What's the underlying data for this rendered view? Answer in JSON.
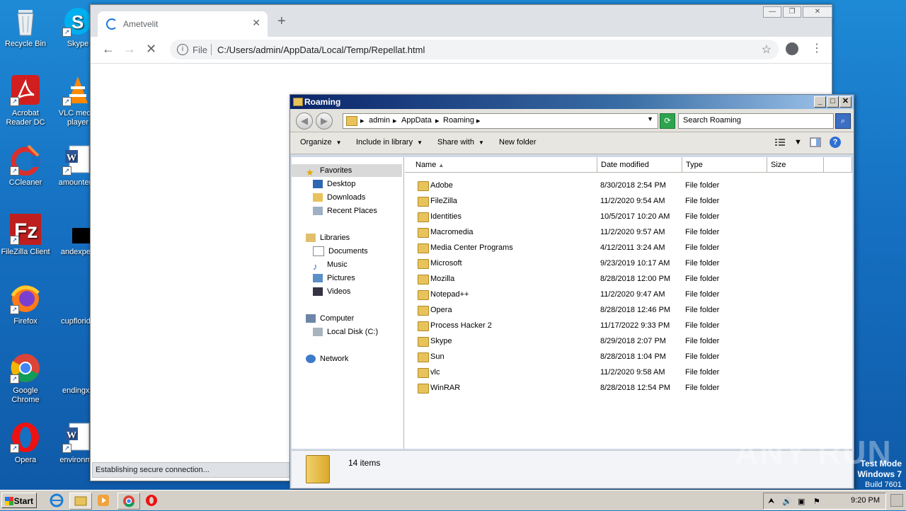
{
  "desktop": {
    "icons": [
      {
        "name": "Recycle Bin"
      },
      {
        "name": "Skype"
      },
      {
        "name": "Acrobat Reader DC"
      },
      {
        "name": "VLC media player"
      },
      {
        "name": "CCleaner"
      },
      {
        "name": "amountenc"
      },
      {
        "name": "FileZilla Client"
      },
      {
        "name": "andexperi"
      },
      {
        "name": "Firefox"
      },
      {
        "name": "cupflorida"
      },
      {
        "name": "Google Chrome"
      },
      {
        "name": "endingxx"
      },
      {
        "name": "Opera"
      },
      {
        "name": "environme"
      }
    ]
  },
  "chrome": {
    "tab_title": "Ametvelit",
    "tab_close": "✕",
    "new_tab": "+",
    "omnibox_scheme": "File",
    "url": "C:/Users/admin/AppData/Local/Temp/Repellat.html",
    "status": "Establishing secure connection..."
  },
  "explorer": {
    "title": "Roaming",
    "breadcrumb": [
      "admin",
      "AppData",
      "Roaming"
    ],
    "search_placeholder": "Search Roaming",
    "toolbar": {
      "organize": "Organize",
      "include": "Include in library",
      "share": "Share with",
      "new_folder": "New folder"
    },
    "nav": {
      "favorites": "Favorites",
      "desktop": "Desktop",
      "downloads": "Downloads",
      "recent": "Recent Places",
      "libraries": "Libraries",
      "documents": "Documents",
      "music": "Music",
      "pictures": "Pictures",
      "videos": "Videos",
      "computer": "Computer",
      "local_disk": "Local Disk (C:)",
      "network": "Network"
    },
    "columns": {
      "name": "Name",
      "date": "Date modified",
      "type": "Type",
      "size": "Size"
    },
    "files": [
      {
        "name": "Adobe",
        "date": "8/30/2018 2:54 PM",
        "type": "File folder"
      },
      {
        "name": "FileZilla",
        "date": "11/2/2020 9:54 AM",
        "type": "File folder"
      },
      {
        "name": "Identities",
        "date": "10/5/2017 10:20 AM",
        "type": "File folder"
      },
      {
        "name": "Macromedia",
        "date": "11/2/2020 9:57 AM",
        "type": "File folder"
      },
      {
        "name": "Media Center Programs",
        "date": "4/12/2011 3:24 AM",
        "type": "File folder"
      },
      {
        "name": "Microsoft",
        "date": "9/23/2019 10:17 AM",
        "type": "File folder"
      },
      {
        "name": "Mozilla",
        "date": "8/28/2018 12:00 PM",
        "type": "File folder"
      },
      {
        "name": "Notepad++",
        "date": "11/2/2020 9:47 AM",
        "type": "File folder"
      },
      {
        "name": "Opera",
        "date": "8/28/2018 12:46 PM",
        "type": "File folder"
      },
      {
        "name": "Process Hacker 2",
        "date": "11/17/2022 9:33 PM",
        "type": "File folder"
      },
      {
        "name": "Skype",
        "date": "8/29/2018 2:07 PM",
        "type": "File folder"
      },
      {
        "name": "Sun",
        "date": "8/28/2018 1:04 PM",
        "type": "File folder"
      },
      {
        "name": "vlc",
        "date": "11/2/2020 9:58 AM",
        "type": "File folder"
      },
      {
        "name": "WinRAR",
        "date": "8/28/2018 12:54 PM",
        "type": "File folder"
      }
    ],
    "item_count": "14 items"
  },
  "watermark": "ANY RUN",
  "testmode": {
    "line1": "Test Mode",
    "line2": "Windows 7",
    "line3": "Build 7601"
  },
  "taskbar": {
    "start": "Start",
    "clock": "9:20 PM"
  }
}
